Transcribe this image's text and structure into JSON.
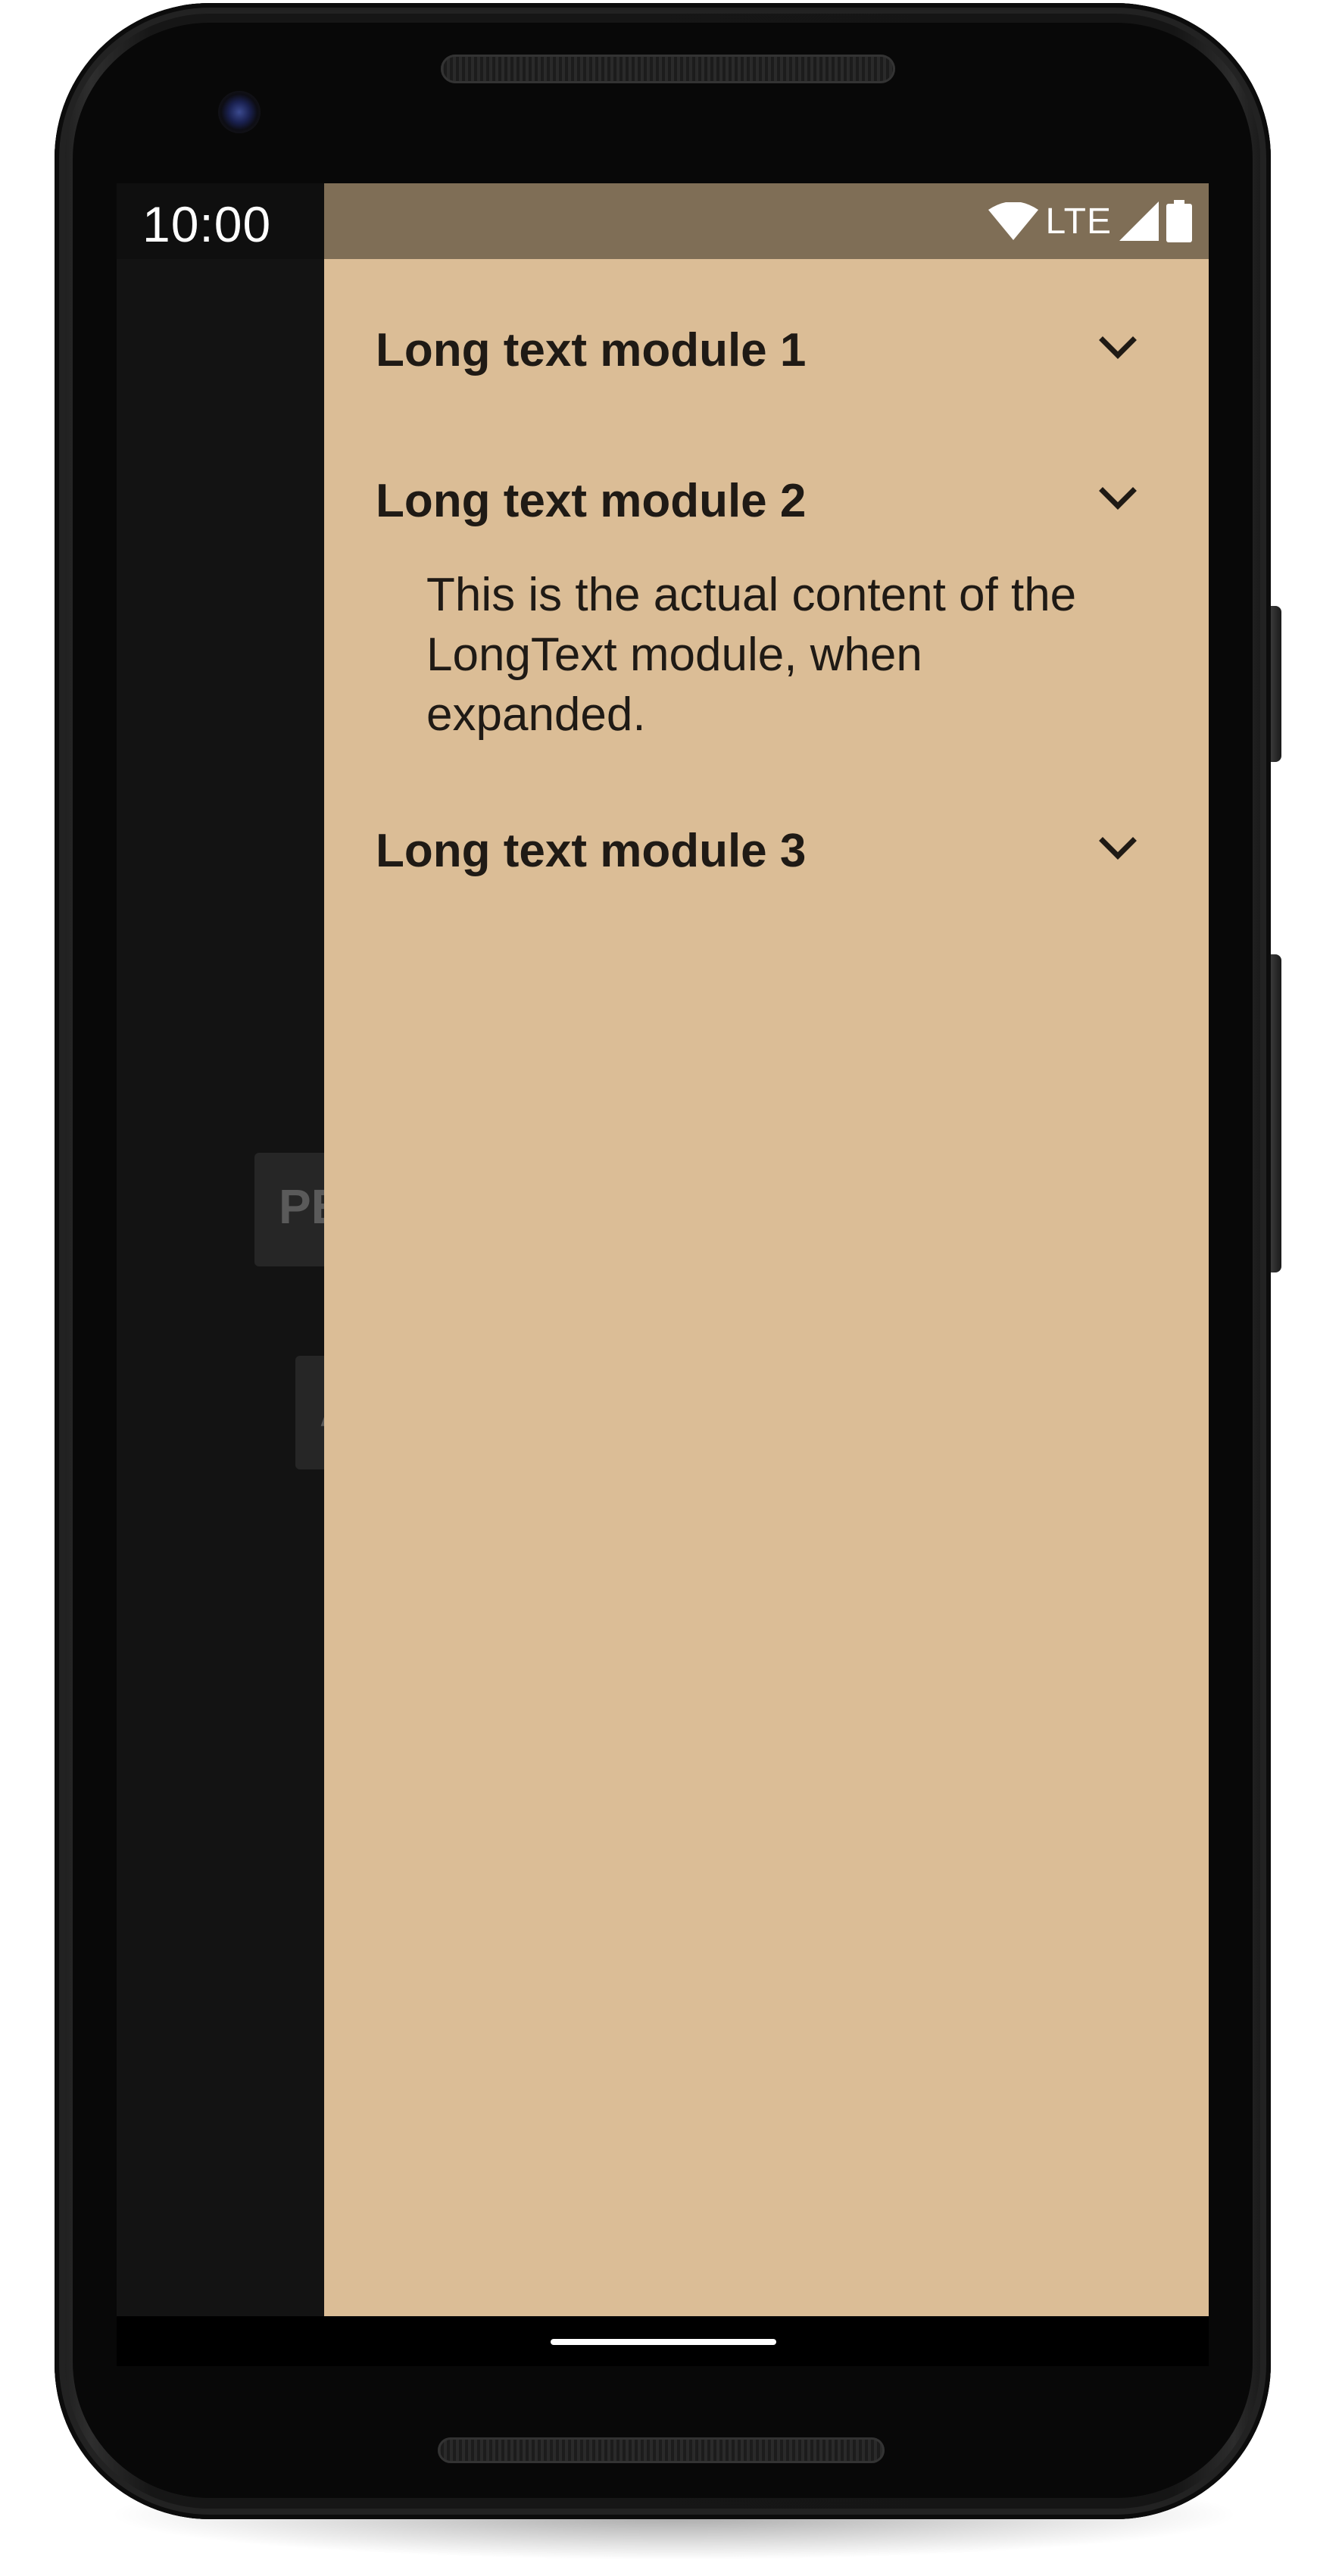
{
  "status_bar": {
    "time": "10:00",
    "network": "LTE",
    "icons": [
      "wifi-icon",
      "lte-signal-icon",
      "battery-icon"
    ]
  },
  "background_app": {
    "button_1_label": "PE",
    "button_2_label": "A"
  },
  "drawer": {
    "background_color": "#dbbd96",
    "status_color": "#7f6e56",
    "modules": [
      {
        "title": "Long text module 1",
        "expanded": false
      },
      {
        "title": "Long text module 2",
        "expanded": true,
        "content": "This is the actual content of the LongText module, when expanded."
      },
      {
        "title": "Long text module 3",
        "expanded": false
      }
    ]
  },
  "nav_bar": {
    "home_indicator": "home-pill"
  }
}
